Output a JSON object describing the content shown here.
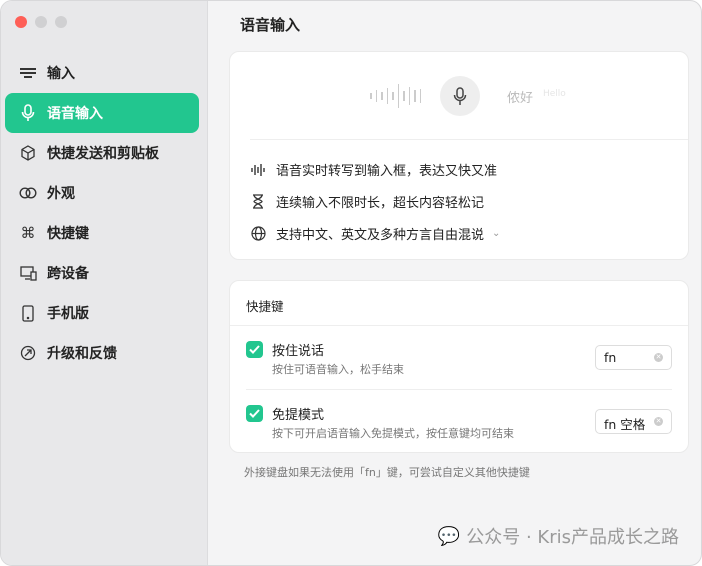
{
  "sidebar": {
    "items": [
      {
        "label": "输入",
        "icon": "keyboard-icon"
      },
      {
        "label": "语音输入",
        "icon": "microphone-icon"
      },
      {
        "label": "快捷发送和剪贴板",
        "icon": "cube-icon"
      },
      {
        "label": "外观",
        "icon": "appearance-icon"
      },
      {
        "label": "快捷键",
        "icon": "command-icon"
      },
      {
        "label": "跨设备",
        "icon": "devices-icon"
      },
      {
        "label": "手机版",
        "icon": "phone-icon"
      },
      {
        "label": "升级和反馈",
        "icon": "upgrade-icon"
      }
    ]
  },
  "main": {
    "title": "语音输入",
    "demo": {
      "text": "侬好",
      "translation": "Hello"
    },
    "features": [
      "语音实时转写到输入框，表达又快又准",
      "连续输入不限时长，超长内容轻松记",
      "支持中文、英文及多种方言自由混说"
    ],
    "shortcuts": {
      "header": "快捷键",
      "rows": [
        {
          "title": "按住说话",
          "desc": "按住可语音输入，松手结束",
          "key": "fn",
          "checked": true
        },
        {
          "title": "免提模式",
          "desc": "按下可开启语音输入免提模式，按任意键均可结束",
          "key": "fn 空格",
          "checked": true
        }
      ]
    },
    "note": "外接键盘如果无法使用「fn」键，可尝试自定义其他快捷键"
  },
  "watermark": "公众号 · Kris产品成长之路",
  "colors": {
    "accent": "#22c68f"
  }
}
